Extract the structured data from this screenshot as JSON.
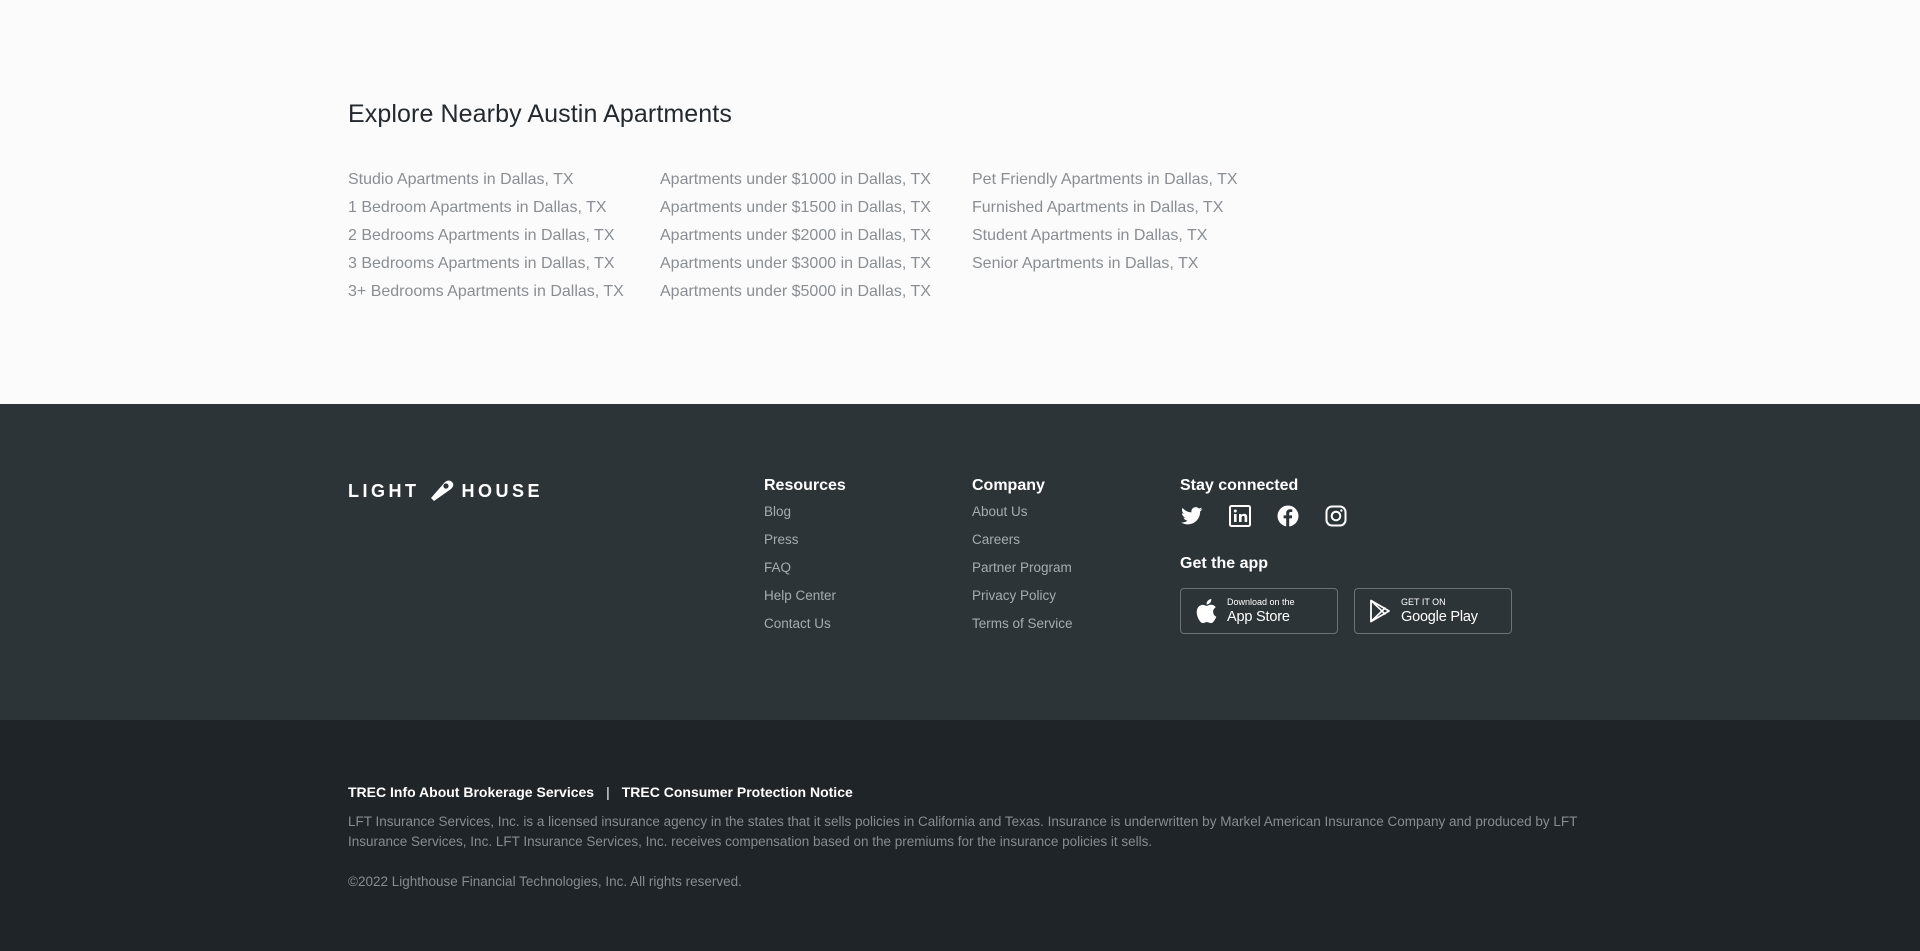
{
  "explore": {
    "title": "Explore Nearby Austin Apartments",
    "columns": [
      [
        "Studio Apartments in Dallas, TX",
        "1 Bedroom Apartments in Dallas, TX",
        "2 Bedrooms Apartments in Dallas, TX",
        "3 Bedrooms Apartments in Dallas, TX",
        "3+ Bedrooms Apartments in Dallas, TX"
      ],
      [
        "Apartments under $1000 in Dallas, TX",
        "Apartments under $1500 in Dallas, TX",
        "Apartments under $2000 in Dallas, TX",
        "Apartments under $3000 in Dallas, TX",
        "Apartments under $5000 in Dallas, TX"
      ],
      [
        "Pet Friendly Apartments in Dallas, TX",
        "Furnished Apartments in Dallas, TX",
        "Student Apartments in Dallas, TX",
        "Senior Apartments in Dallas, TX"
      ]
    ]
  },
  "footer": {
    "logo": {
      "left": "LIGHT",
      "right": "HOUSE"
    },
    "resources": {
      "title": "Resources",
      "links": [
        "Blog",
        "Press",
        "FAQ",
        "Help Center",
        "Contact Us"
      ]
    },
    "company": {
      "title": "Company",
      "links": [
        "About Us",
        "Careers",
        "Partner Program",
        "Privacy Policy",
        "Terms of Service"
      ]
    },
    "stay_connected": {
      "title": "Stay connected",
      "icons": [
        "twitter-icon",
        "linkedin-icon",
        "facebook-icon",
        "instagram-icon"
      ]
    },
    "get_app": {
      "title": "Get the app",
      "app_store": {
        "small": "Download on the",
        "big": "App Store"
      },
      "google_play": {
        "small": "GET IT ON",
        "big": "Google Play"
      }
    }
  },
  "legal": {
    "trec_info": "TREC Info About Brokerage Services",
    "separator": "|",
    "trec_notice": "TREC Consumer Protection Notice",
    "disclaimer": "LFT Insurance Services, Inc. is a licensed insurance agency in the states that it sells policies in California and Texas. Insurance is underwritten by Markel American Insurance Company and produced by LFT Insurance Services, Inc. LFT Insurance Services, Inc. receives compensation based on the premiums for the insurance policies it sells.",
    "copyright": "©2022 Lighthouse Financial Technologies, Inc. All rights reserved."
  },
  "colors": {
    "footer_bg": "#2c3438",
    "legal_bg": "#1f2428",
    "page_bg": "#fbfbfb",
    "link_gray": "#8a8e92"
  }
}
